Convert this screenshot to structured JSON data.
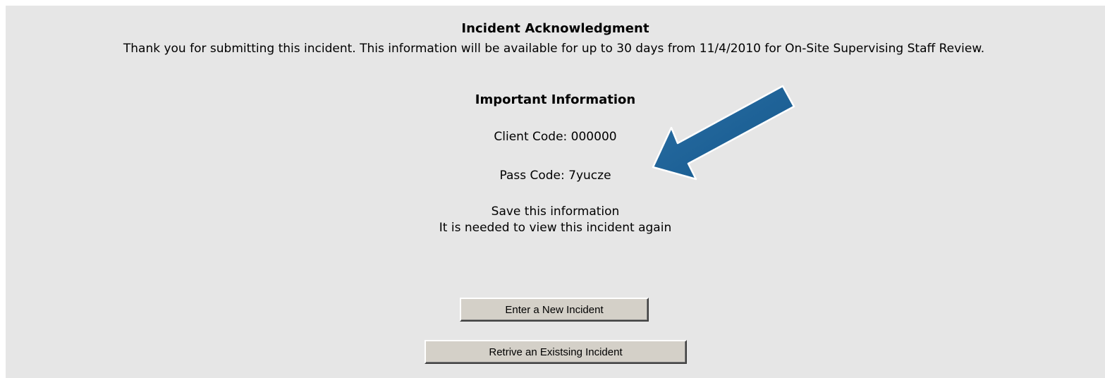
{
  "page": {
    "title": "Incident Acknowledgment",
    "message": "Thank you for submitting this incident.  This information will be available for up to 30 days from 11/4/2010 for On-Site Supervising Staff Review.",
    "subtitle": "Important Information",
    "client_code": "Client Code: 000000",
    "pass_code": "Pass Code: 7yucze",
    "save_line1": "Save this information",
    "save_line2": "It is needed to view this incident again"
  },
  "buttons": {
    "new_incident": "Enter a New Incident",
    "retrieve_incident": "Retrive an Existsing Incident"
  },
  "colors": {
    "panel_background": "#e6e6e6",
    "arrow": "#1b5f93",
    "button_face": "#d4d0c8"
  },
  "icons": {
    "annotation_arrow": "arrow-icon"
  }
}
